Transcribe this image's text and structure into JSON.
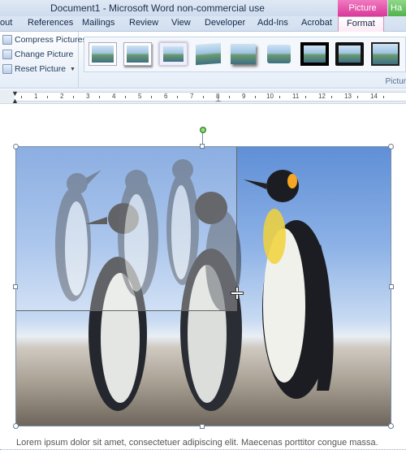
{
  "window": {
    "title": "Document1  -  Microsoft Word non-commercial use",
    "context_tab_group": "Picture Tools",
    "context_tab_group_2": "Ha"
  },
  "tabs": [
    {
      "label": "out"
    },
    {
      "label": "References"
    },
    {
      "label": "Mailings"
    },
    {
      "label": "Review"
    },
    {
      "label": "View"
    },
    {
      "label": "Developer"
    },
    {
      "label": "Add-Ins"
    },
    {
      "label": "Acrobat"
    },
    {
      "label": "Format"
    }
  ],
  "adjust": {
    "compress": "Compress Pictures",
    "change": "Change Picture",
    "reset": "Reset Picture"
  },
  "picture_styles": {
    "group_label": "Pictur",
    "thumb_count": 9
  },
  "ruler": {
    "numbers": [
      "1",
      "2",
      "3",
      "4",
      "5",
      "6",
      "7",
      "8",
      "9",
      "10",
      "11",
      "12",
      "13",
      "14"
    ]
  },
  "document": {
    "body_text": "Lorem ipsum dolor sit amet, consectetuer adipiscing elit. Maecenas porttitor congue massa."
  },
  "colors": {
    "context_tab": "#d9399a",
    "context_tab_2": "#4fb34a",
    "rotation_handle": "#3fa82c"
  }
}
